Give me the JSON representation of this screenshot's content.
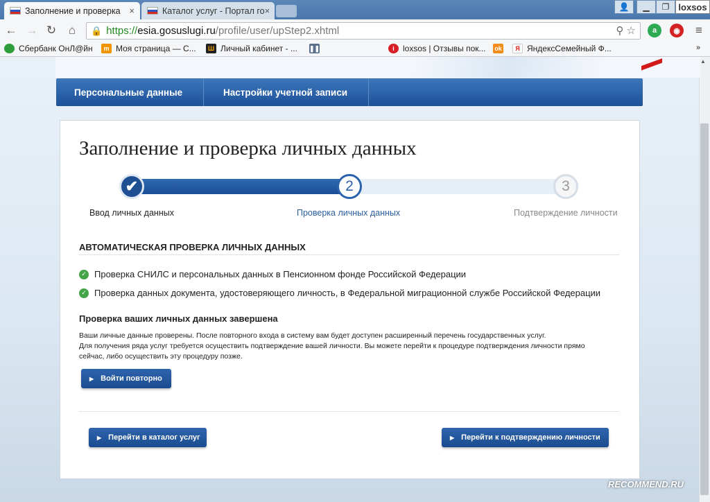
{
  "browser": {
    "tabs": [
      {
        "title": "Заполнение и проверка"
      },
      {
        "title": "Каталог услуг - Портал го"
      }
    ],
    "user": "loxsos",
    "url": {
      "scheme": "https://",
      "host": "esia.gosuslugi.ru",
      "path": "/profile/user/upStep2.xhtml"
    },
    "bookmarks": [
      {
        "label": "Сбербанк ОнЛ@йн"
      },
      {
        "label": "Моя страница — С..."
      },
      {
        "label": "Личный кабинет - ..."
      },
      {
        "label": "loxsos | Отзывы пок..."
      },
      {
        "label": "ЯндексСемейный Ф..."
      }
    ]
  },
  "nav": {
    "items": [
      {
        "label": "Персональные данные"
      },
      {
        "label": "Настройки учетной записи"
      }
    ]
  },
  "page": {
    "title": "Заполнение и проверка личных данных",
    "steps": [
      {
        "number": "",
        "label": "Ввод личных данных",
        "state": "done"
      },
      {
        "number": "2",
        "label": "Проверка личных данных",
        "state": "current"
      },
      {
        "number": "3",
        "label": "Подтверждение личности",
        "state": "pending"
      }
    ],
    "progress_fraction": 0.5,
    "section_title": "Автоматическая проверка личных данных",
    "checks": [
      "Проверка СНИЛС и персональных данных в Пенсионном фонде Российской Федерации",
      "Проверка данных документа, удостоверяющего личность, в Федеральной миграционной службе Российской Федерации"
    ],
    "done_title": "Проверка ваших личных данных завершена",
    "note_lines": [
      "Ваши личные данные проверены. После повторного входа в систему вам будет доступен расширенный перечень государственных услуг.",
      "Для получения ряда услуг требуется осуществить подтверждение вашей личности. Вы можете перейти к процедуре подтверждения личности прямо",
      "сейчас, либо осуществить эту процедуру позже."
    ],
    "relogin_button": "Войти повторно",
    "catalog_button": "Перейти в каталог услуг",
    "confirm_button": "Перейти к подтверждению личности"
  },
  "watermark": "RECOMMEND.RU",
  "colors": {
    "accent": "#1d5199",
    "check": "#45a447"
  }
}
